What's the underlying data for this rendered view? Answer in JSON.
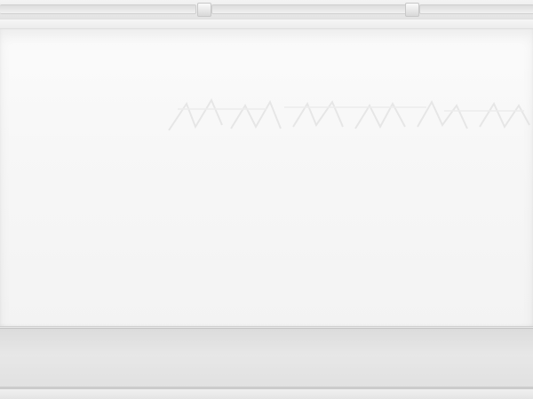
{
  "product": {
    "type": "wall-mounted air conditioner indoor unit",
    "body_color": "#f7f7f7",
    "grille_color": "#e2e2e2",
    "louver_color": "#e1e1e1"
  }
}
